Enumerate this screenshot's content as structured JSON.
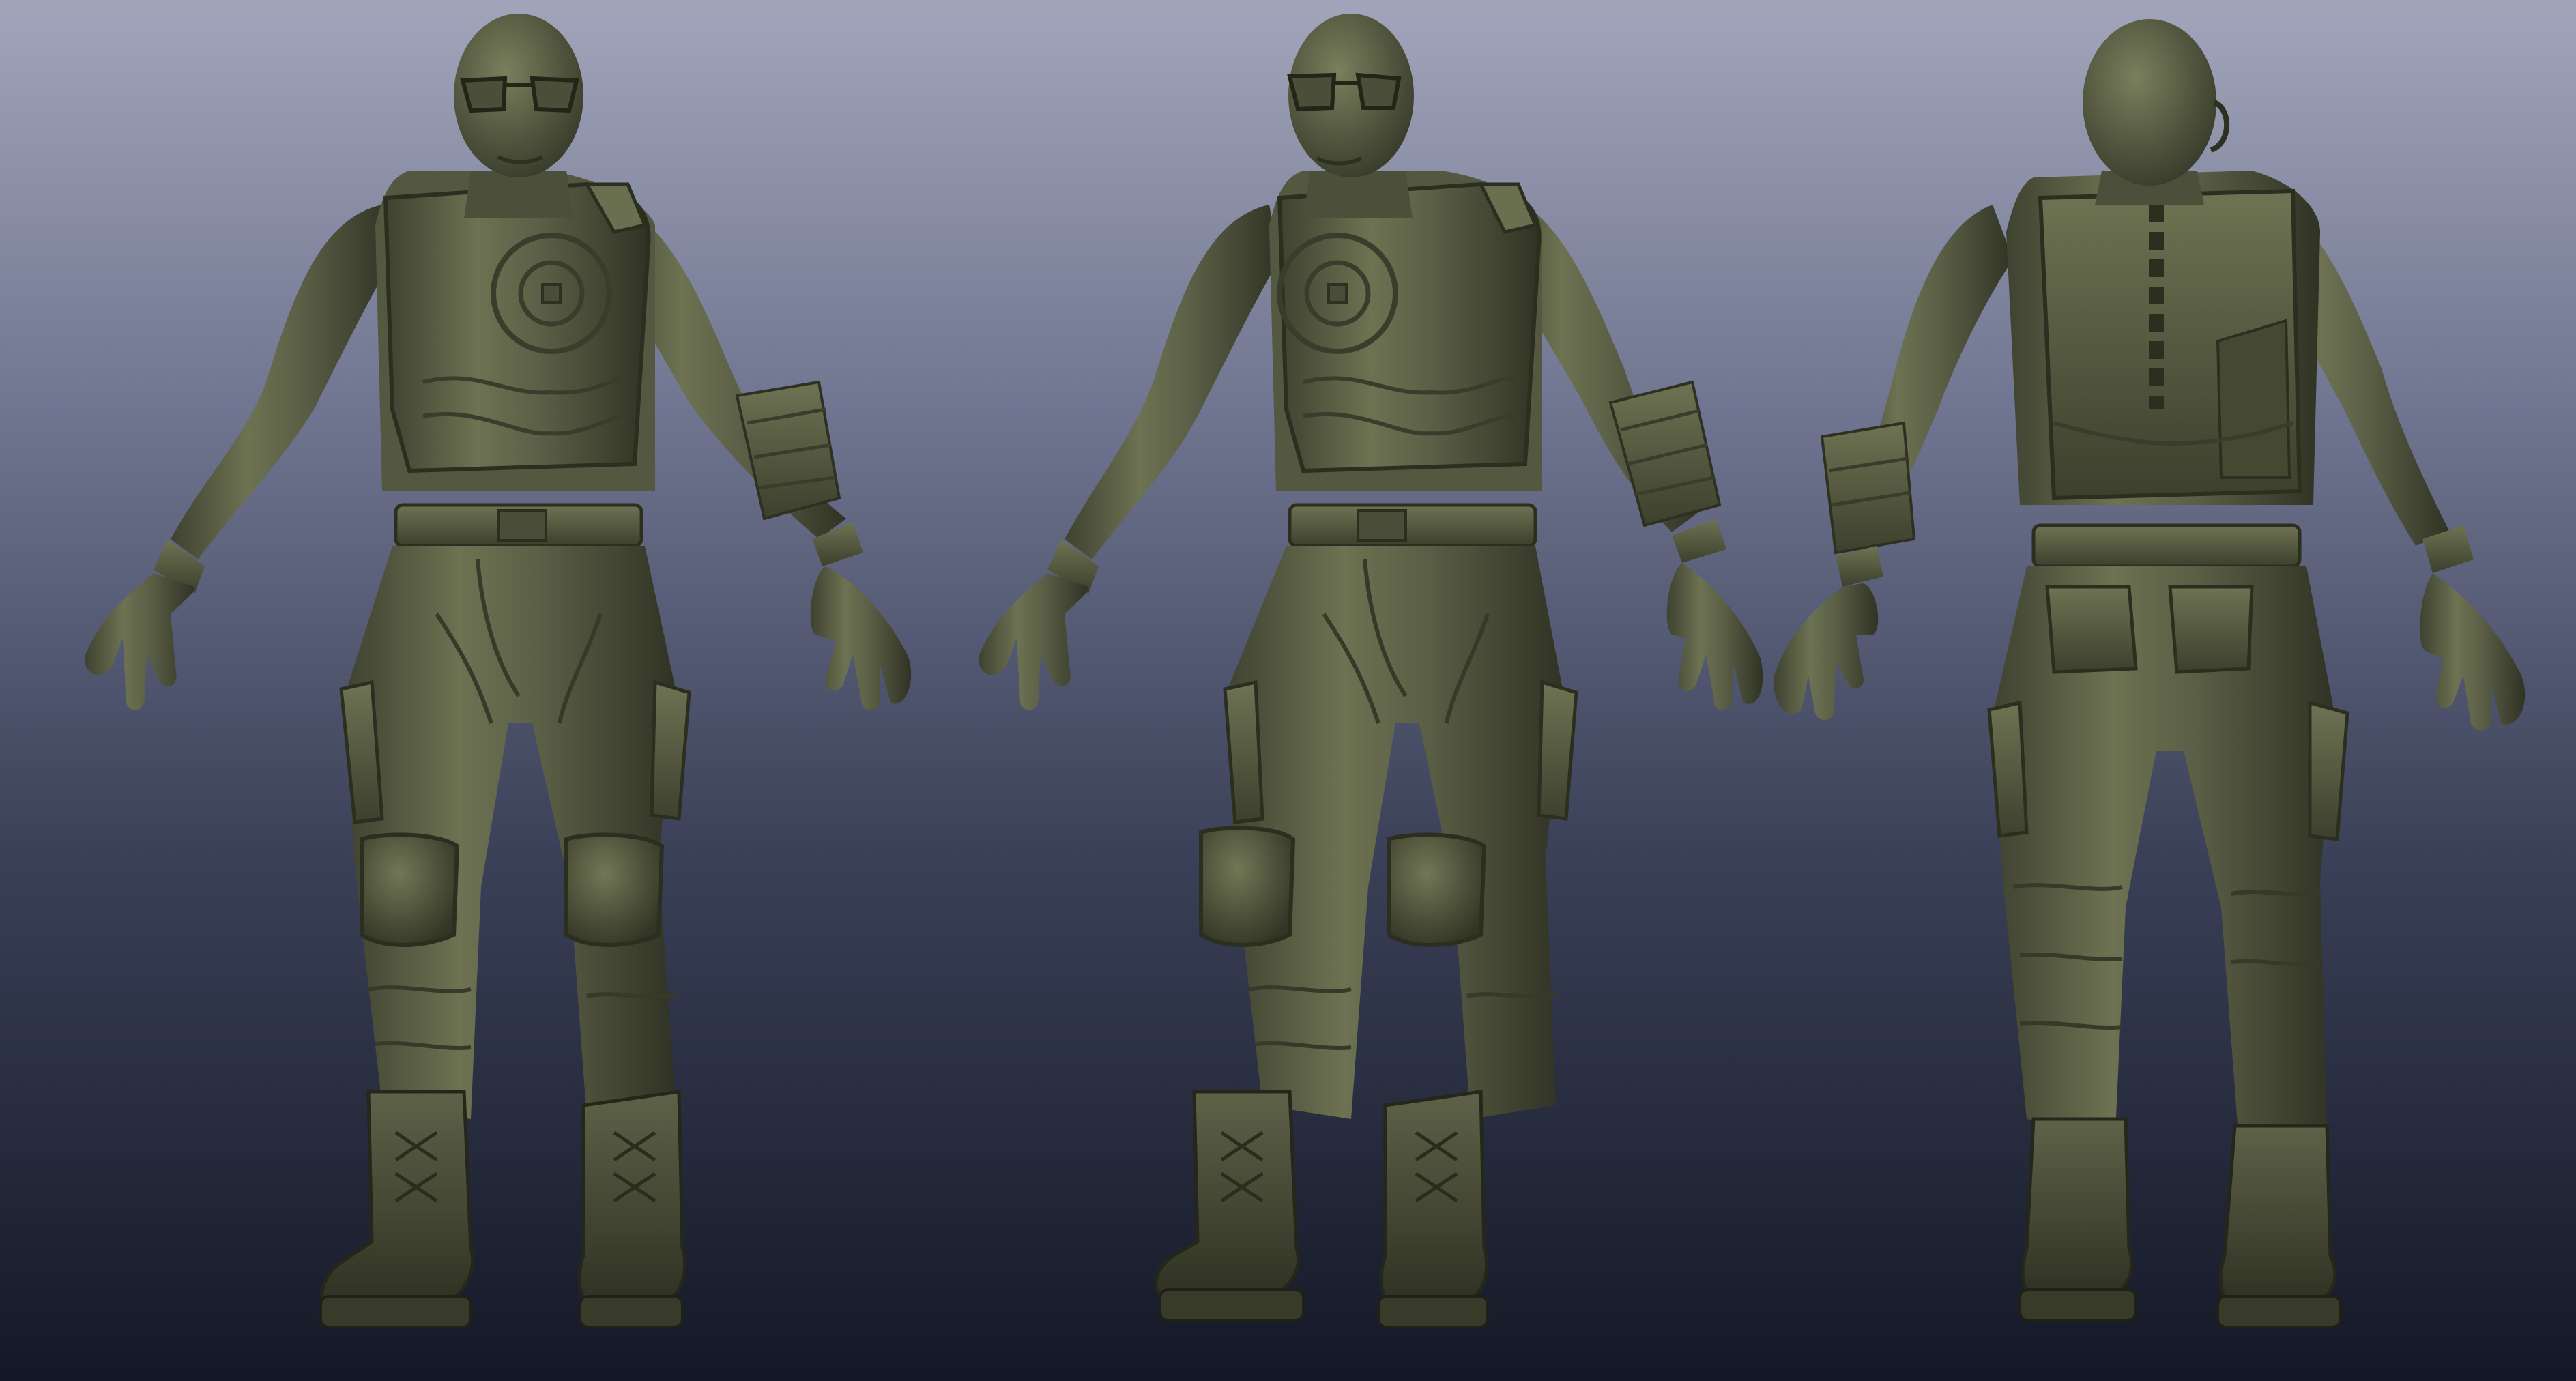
{
  "scene": {
    "colors": {
      "background_top": "#a2a5ba",
      "background_mid": "#6f7590",
      "background_bottom": "#141826",
      "clay_base": "#5a5e45",
      "clay_light": "#7d8261",
      "clay_dark": "#343726",
      "clay_shadow": "#262819"
    },
    "figures": [
      {
        "id": "front",
        "view": "front"
      },
      {
        "id": "three-quarter",
        "view": "three-quarter"
      },
      {
        "id": "back",
        "view": "back"
      }
    ]
  }
}
